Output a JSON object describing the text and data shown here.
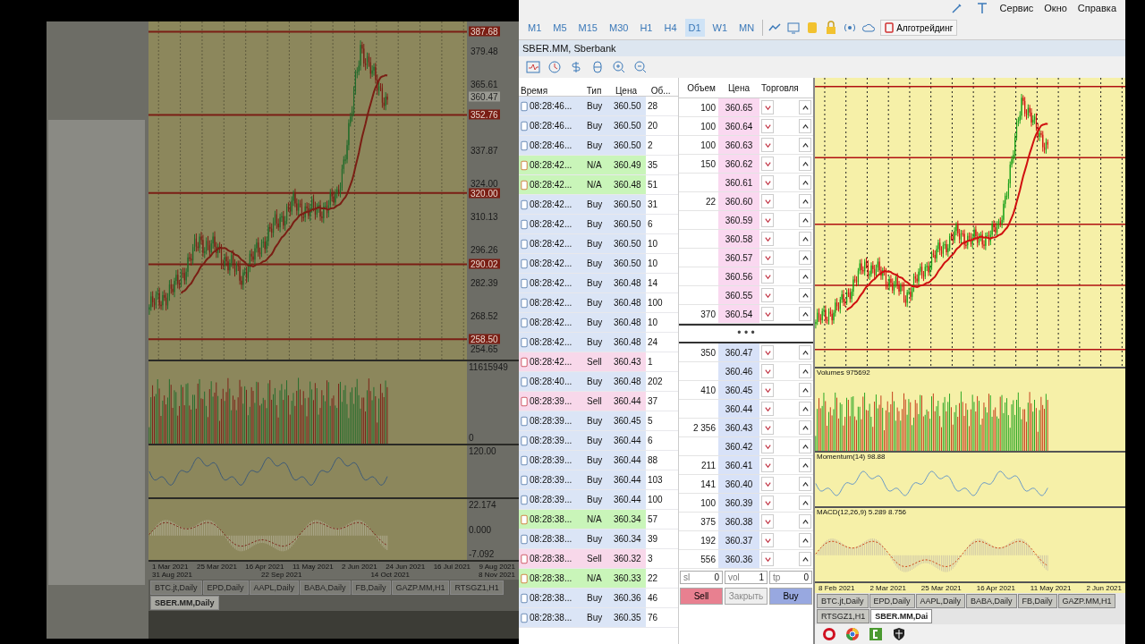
{
  "left_window": {
    "price_axis": [
      {
        "label": "387.68",
        "kind": "level"
      },
      {
        "label": "379.48",
        "kind": "tick"
      },
      {
        "label": "365.61",
        "kind": "tick"
      },
      {
        "label": "360.47",
        "kind": "current"
      },
      {
        "label": "352.76",
        "kind": "level"
      },
      {
        "label": "337.87",
        "kind": "tick"
      },
      {
        "label": "324.00",
        "kind": "tick"
      },
      {
        "label": "320.00",
        "kind": "level"
      },
      {
        "label": "310.13",
        "kind": "tick"
      },
      {
        "label": "296.26",
        "kind": "tick"
      },
      {
        "label": "290.02",
        "kind": "level"
      },
      {
        "label": "282.39",
        "kind": "tick"
      },
      {
        "label": "268.52",
        "kind": "tick"
      },
      {
        "label": "258.50",
        "kind": "level"
      },
      {
        "label": "254.65",
        "kind": "tick"
      }
    ],
    "volume_axis": [
      "11615949",
      "0"
    ],
    "momentum_axis": [
      "120.00"
    ],
    "macd_axis": [
      "22.174",
      "0.000",
      "-7.092"
    ],
    "dates": [
      "1 Mar 2021",
      "25 Mar 2021",
      "16 Apr 2021",
      "11 May 2021",
      "2 Jun 2021",
      "24 Jun 2021",
      "16 Jul 2021",
      "9 Aug 2021",
      "31 Aug 2021",
      "22 Sep 2021",
      "14 Oct 2021",
      "8 Nov 2021"
    ],
    "tabs": [
      {
        "label": "BTC.jt,Daily",
        "selected": false
      },
      {
        "label": "EPD,Daily",
        "selected": false
      },
      {
        "label": "AAPL,Daily",
        "selected": false
      },
      {
        "label": "BABA,Daily",
        "selected": false
      },
      {
        "label": "FB,Daily",
        "selected": false
      },
      {
        "label": "GAZP.MM,H1",
        "selected": false
      },
      {
        "label": "RTSGZ1,H1",
        "selected": false
      },
      {
        "label": "SBER.MM,Daily",
        "selected": true
      }
    ]
  },
  "right_window": {
    "menu": [
      "Сервис",
      "Окно",
      "Справка"
    ],
    "timeframes": [
      {
        "label": "M1",
        "selected": false
      },
      {
        "label": "M5",
        "selected": false
      },
      {
        "label": "M15",
        "selected": false
      },
      {
        "label": "M30",
        "selected": false
      },
      {
        "label": "H1",
        "selected": false
      },
      {
        "label": "H4",
        "selected": false
      },
      {
        "label": "D1",
        "selected": true
      },
      {
        "label": "W1",
        "selected": false
      },
      {
        "label": "MN",
        "selected": false
      }
    ],
    "algo_button": "Алготрейдинг",
    "symbol_title": "SBER.MM, Sberbank",
    "time_and_sales": {
      "columns": [
        "Время",
        "Тип",
        "Цена",
        "Об..."
      ],
      "rows": [
        {
          "time": "08:28:46...",
          "type": "Buy",
          "kind": "buy",
          "price": "360.50",
          "volume": "28"
        },
        {
          "time": "08:28:46...",
          "type": "Buy",
          "kind": "buy",
          "price": "360.50",
          "volume": "20"
        },
        {
          "time": "08:28:46...",
          "type": "Buy",
          "kind": "buy",
          "price": "360.50",
          "volume": "2"
        },
        {
          "time": "08:28:42...",
          "type": "N/A",
          "kind": "na",
          "price": "360.49",
          "volume": "35"
        },
        {
          "time": "08:28:42...",
          "type": "N/A",
          "kind": "na",
          "price": "360.48",
          "volume": "51"
        },
        {
          "time": "08:28:42...",
          "type": "Buy",
          "kind": "buy",
          "price": "360.50",
          "volume": "31"
        },
        {
          "time": "08:28:42...",
          "type": "Buy",
          "kind": "buy",
          "price": "360.50",
          "volume": "6"
        },
        {
          "time": "08:28:42...",
          "type": "Buy",
          "kind": "buy",
          "price": "360.50",
          "volume": "10"
        },
        {
          "time": "08:28:42...",
          "type": "Buy",
          "kind": "buy",
          "price": "360.50",
          "volume": "10"
        },
        {
          "time": "08:28:42...",
          "type": "Buy",
          "kind": "buy",
          "price": "360.48",
          "volume": "14"
        },
        {
          "time": "08:28:42...",
          "type": "Buy",
          "kind": "buy",
          "price": "360.48",
          "volume": "100"
        },
        {
          "time": "08:28:42...",
          "type": "Buy",
          "kind": "buy",
          "price": "360.48",
          "volume": "10"
        },
        {
          "time": "08:28:42...",
          "type": "Buy",
          "kind": "buy",
          "price": "360.48",
          "volume": "24"
        },
        {
          "time": "08:28:42...",
          "type": "Sell",
          "kind": "sell",
          "price": "360.43",
          "volume": "1"
        },
        {
          "time": "08:28:40...",
          "type": "Buy",
          "kind": "buy",
          "price": "360.48",
          "volume": "202"
        },
        {
          "time": "08:28:39...",
          "type": "Sell",
          "kind": "sell",
          "price": "360.44",
          "volume": "37"
        },
        {
          "time": "08:28:39...",
          "type": "Buy",
          "kind": "buy",
          "price": "360.45",
          "volume": "5"
        },
        {
          "time": "08:28:39...",
          "type": "Buy",
          "kind": "buy",
          "price": "360.44",
          "volume": "6"
        },
        {
          "time": "08:28:39...",
          "type": "Buy",
          "kind": "buy",
          "price": "360.44",
          "volume": "88"
        },
        {
          "time": "08:28:39...",
          "type": "Buy",
          "kind": "buy",
          "price": "360.44",
          "volume": "103"
        },
        {
          "time": "08:28:39...",
          "type": "Buy",
          "kind": "buy",
          "price": "360.44",
          "volume": "100"
        },
        {
          "time": "08:28:38...",
          "type": "N/A",
          "kind": "na",
          "price": "360.34",
          "volume": "57"
        },
        {
          "time": "08:28:38...",
          "type": "Buy",
          "kind": "buy",
          "price": "360.34",
          "volume": "39"
        },
        {
          "time": "08:28:38...",
          "type": "Sell",
          "kind": "sell",
          "price": "360.32",
          "volume": "3"
        },
        {
          "time": "08:28:38...",
          "type": "N/A",
          "kind": "na",
          "price": "360.33",
          "volume": "22"
        },
        {
          "time": "08:28:38...",
          "type": "Buy",
          "kind": "buy",
          "price": "360.36",
          "volume": "46"
        },
        {
          "time": "08:28:38...",
          "type": "Buy",
          "kind": "buy",
          "price": "360.35",
          "volume": "76"
        }
      ]
    },
    "depth_of_market": {
      "columns": [
        "Объем",
        "Цена",
        "Торговля"
      ],
      "asks": [
        {
          "volume": "100",
          "price": "360.65"
        },
        {
          "volume": "100",
          "price": "360.64"
        },
        {
          "volume": "100",
          "price": "360.63"
        },
        {
          "volume": "150",
          "price": "360.62"
        },
        {
          "price": "360.61"
        },
        {
          "volume": "22",
          "price": "360.60"
        },
        {
          "price": "360.59"
        },
        {
          "price": "360.58"
        },
        {
          "price": "360.57"
        },
        {
          "price": "360.56"
        },
        {
          "price": "360.55"
        },
        {
          "volume": "370",
          "price": "360.54"
        }
      ],
      "separator": "• • •",
      "bids": [
        {
          "volume": "350",
          "price": "360.47"
        },
        {
          "price": "360.46"
        },
        {
          "volume": "410",
          "price": "360.45"
        },
        {
          "price": "360.44"
        },
        {
          "volume": "2 356",
          "price": "360.43"
        },
        {
          "price": "360.42"
        },
        {
          "volume": "211",
          "price": "360.41"
        },
        {
          "volume": "141",
          "price": "360.40"
        },
        {
          "volume": "100",
          "price": "360.39"
        },
        {
          "volume": "375",
          "price": "360.38"
        },
        {
          "volume": "192",
          "price": "360.37"
        },
        {
          "volume": "556",
          "price": "360.36"
        }
      ],
      "controls": {
        "sl_label": "sl",
        "sl_value": "0",
        "vol_label": "vol",
        "vol_value": "1",
        "tp_label": "tp",
        "tp_value": "0",
        "sell": "Sell",
        "close": "Закрыть",
        "buy": "Buy"
      }
    },
    "chart": {
      "volume_label": "Volumes 975692",
      "momentum_label": "Momentum(14) 98.88",
      "macd_label": "MACD(12,26,9) 5.289 8.756",
      "dates": [
        "8 Feb 2021",
        "2 Mar 2021",
        "25 Mar 2021",
        "16 Apr 2021",
        "11 May 2021",
        "2 Jun 2021"
      ],
      "tabs": [
        {
          "label": "BTC.jt,Daily",
          "selected": false
        },
        {
          "label": "EPD,Daily",
          "selected": false
        },
        {
          "label": "AAPL,Daily",
          "selected": false
        },
        {
          "label": "BABA,Daily",
          "selected": false
        },
        {
          "label": "FB,Daily",
          "selected": false
        },
        {
          "label": "GAZP.MM,H1",
          "selected": false
        },
        {
          "label": "RTSGZ1,H1",
          "selected": false
        },
        {
          "label": "SBER.MM,Dai",
          "selected": true
        }
      ]
    }
  }
}
